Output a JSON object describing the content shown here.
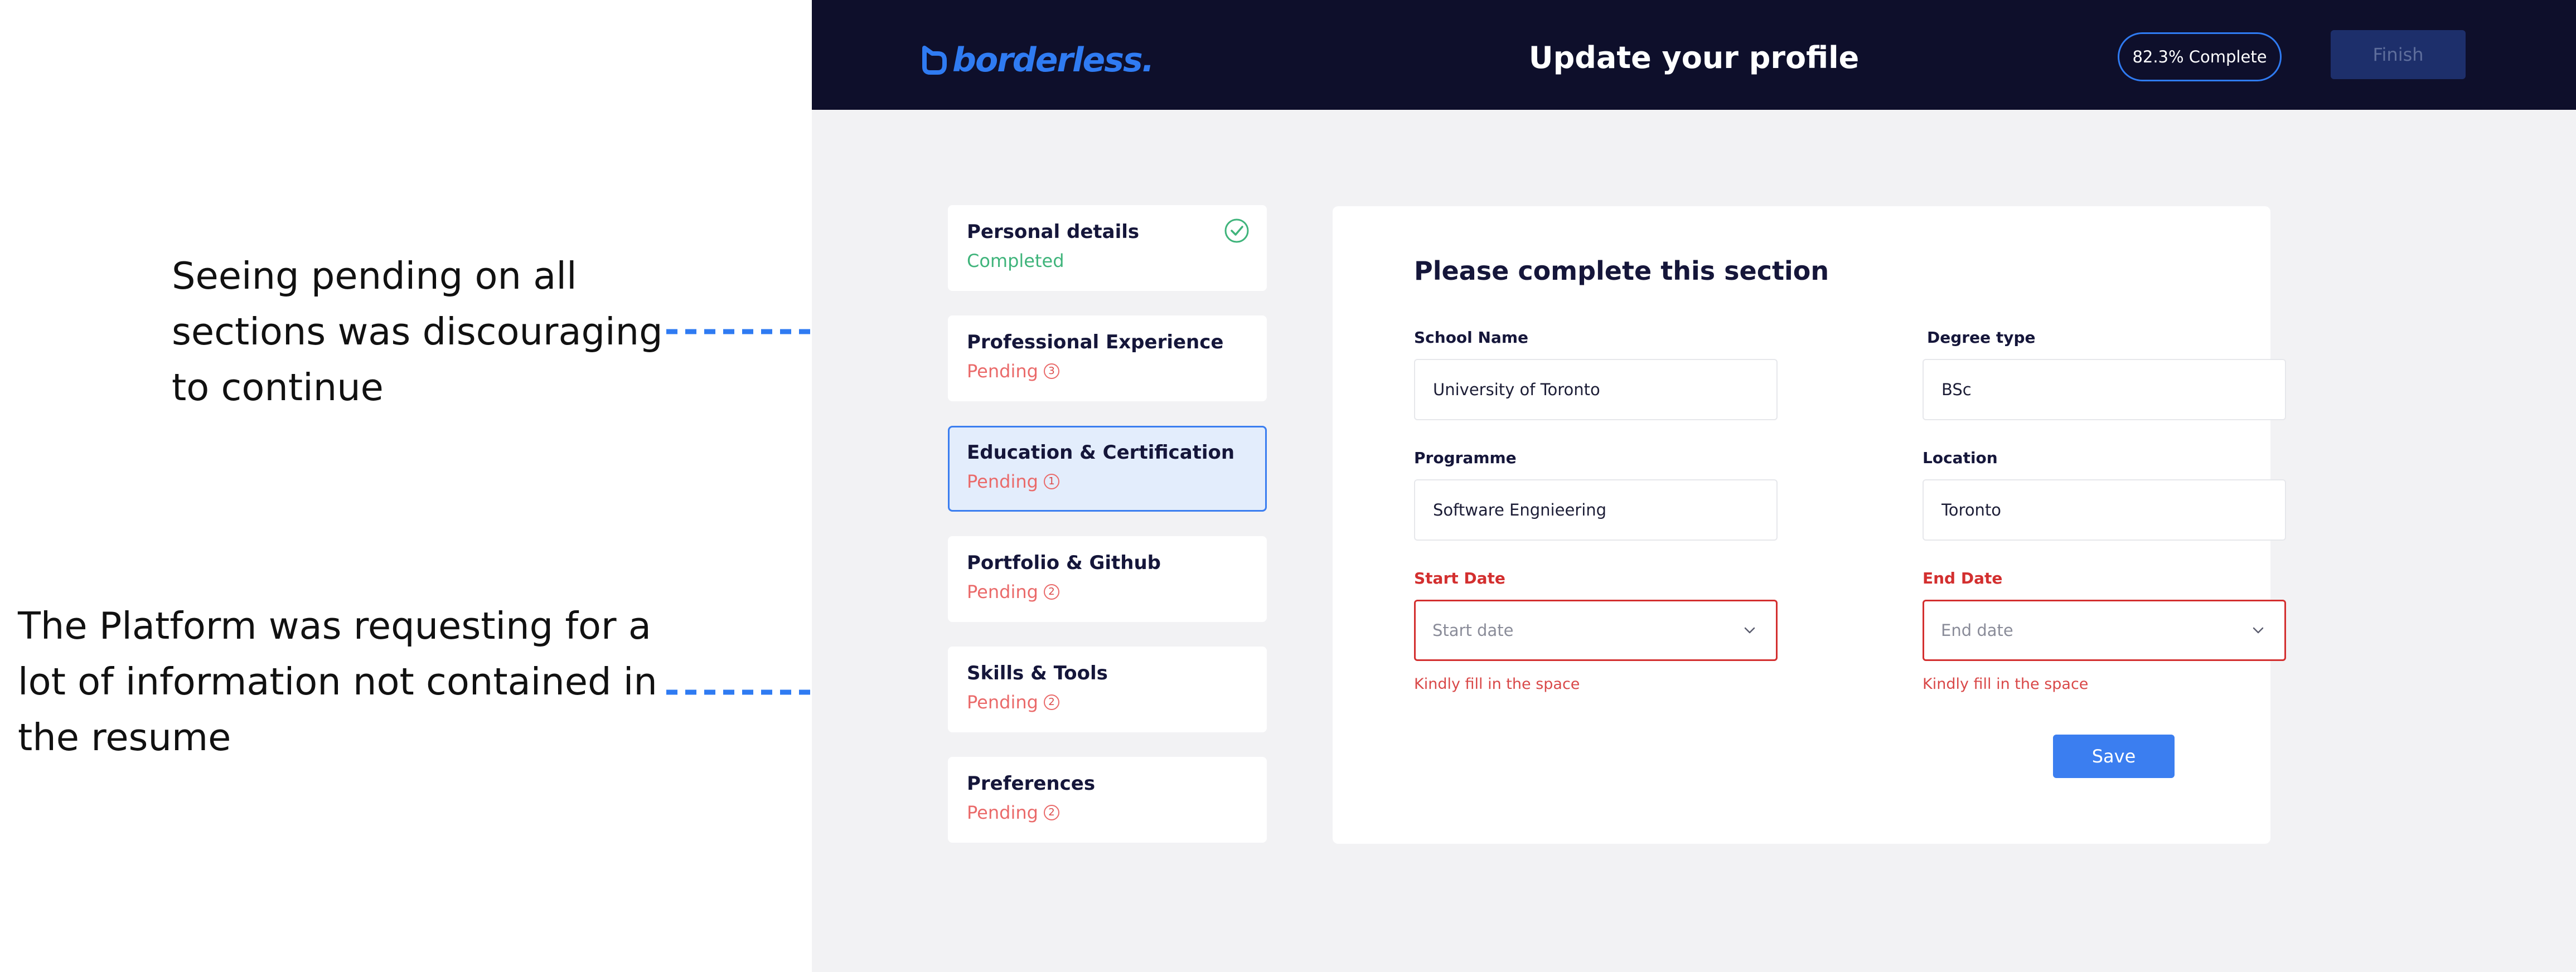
{
  "annotations": [
    {
      "text": "Seeing pending on all sections was discouraging to continue"
    },
    {
      "text": "The Platform was requesting for a lot of information not contained in the resume"
    }
  ],
  "colors": {
    "header_bg": "#0e0f2b",
    "accent": "#2f7bf2",
    "pending": "#ea6a6a",
    "completed": "#3fb47b",
    "error": "#d32f2f"
  },
  "header": {
    "logo_text": "borderless.",
    "title": "Update your profile",
    "progress_label": "82.3% Complete",
    "progress_percent": 82.3,
    "finish_label": "Finish"
  },
  "sidebar": {
    "items": [
      {
        "label": "Personal details",
        "status": "Completed",
        "icon": "check-circle-icon"
      },
      {
        "label": "Professional Experience",
        "status": "Pending",
        "count": "3"
      },
      {
        "label": "Education & Certification",
        "status": "Pending",
        "count": "1",
        "active": true
      },
      {
        "label": "Portfolio & Github",
        "status": "Pending",
        "count": "2"
      },
      {
        "label": "Skills & Tools",
        "status": "Pending",
        "count": "2"
      },
      {
        "label": "Preferences",
        "status": "Pending",
        "count": "2"
      }
    ]
  },
  "form": {
    "title": "Please complete this section",
    "school": {
      "label": "School Name",
      "value": "University of Toronto"
    },
    "degree": {
      "label": "Degree type",
      "value": "BSc"
    },
    "programme": {
      "label": "Programme",
      "value": "Software Engnieering"
    },
    "location": {
      "label": "Location",
      "value": "Toronto"
    },
    "start_date": {
      "label": "Start Date",
      "placeholder": "Start date",
      "error": "Kindly fill in the space"
    },
    "end_date": {
      "label": "End Date",
      "placeholder": "End date",
      "error": "Kindly fill in the space"
    },
    "save_label": "Save"
  }
}
